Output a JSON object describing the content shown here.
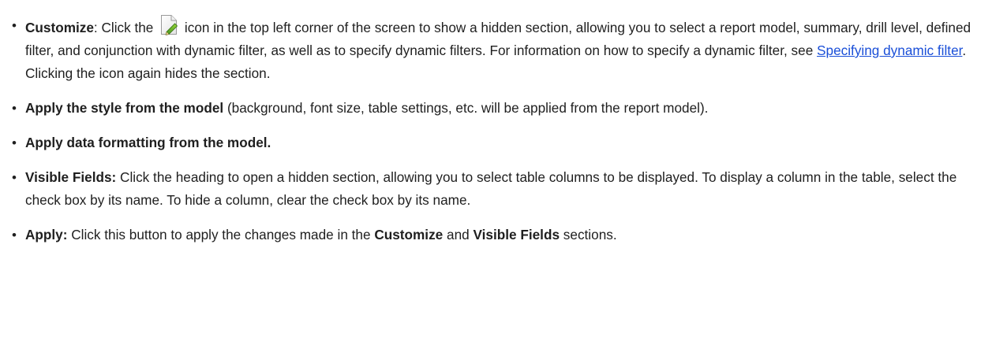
{
  "items": [
    {
      "term": "Customize",
      "sep": ":",
      "text_before_icon": " Click  the ",
      "icon": "document-edit-icon",
      "text_after_icon": " icon in the top left corner of the screen to show a hidden section, allowing you to select a report model, summary, drill level, defined filter, and conjunction with dynamic filter, as well as to specify dynamic filters. For information on how to specify a dynamic filter, see ",
      "link_text": "Specifying dynamic filter",
      "text_after_link": ". Clicking the icon again hides the section."
    },
    {
      "term": "Apply the style from the model",
      "text": " (background, font size, table settings, etc. will be applied from the report model)."
    },
    {
      "term": "Apply data formatting from the model."
    },
    {
      "term": "Visible Fields:",
      "text": " Click the heading to open a hidden section, allowing you to select table columns to be displayed. To display a column in the table, select the check box by its name. To hide a column, clear the check box by its name."
    },
    {
      "term": "Apply:",
      "text_1": " Click this button to apply the changes made in the ",
      "bold_1": "Customize",
      "text_2": " and ",
      "bold_2": "Visible Fields",
      "text_3": " sections."
    }
  ],
  "bullet": "•",
  "colors": {
    "text": "#1f1f1f",
    "link": "#1a4fd8"
  }
}
